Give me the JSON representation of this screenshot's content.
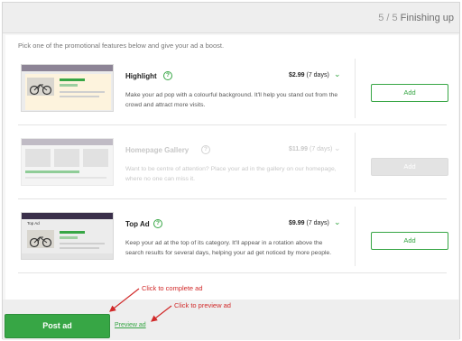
{
  "header": {
    "step_count": "5 / 5",
    "step_title": "Finishing up"
  },
  "intro": "Pick one of the promotional features below and give your ad a boost.",
  "features": [
    {
      "title": "Highlight",
      "help_icon": "question-circle-icon",
      "price": "$2.99",
      "duration": "(7 days)",
      "description": "Make your ad pop with a colourful background. It'll help you stand out from the crowd and attract more visits.",
      "button": "Add",
      "state": "enabled"
    },
    {
      "title": "Homepage Gallery",
      "help_icon": "question-circle-icon",
      "price": "$11.99",
      "duration": "(7 days)",
      "description": "Want to be centre of attention? Place your ad in the gallery on our homepage, where no one can miss it.",
      "button": "Add",
      "state": "disabled"
    },
    {
      "title": "Top Ad",
      "help_icon": "question-circle-icon",
      "price": "$9.99",
      "duration": "(7 days)",
      "description": "Keep your ad at the top of its category. It'll appear in a rotation above the search results for several days, helping your ad get noticed by more people.",
      "button": "Add",
      "state": "enabled",
      "thumb_label": "Top Ad"
    }
  ],
  "footer": {
    "post_button": "Post ad",
    "preview_link": "Preview ad"
  },
  "annotations": {
    "complete": "Click to complete ad",
    "preview": "Click to preview ad"
  },
  "colors": {
    "accent": "#37a645",
    "annotation": "#d12a2a",
    "highlight_bg": "#fdf3dd"
  }
}
